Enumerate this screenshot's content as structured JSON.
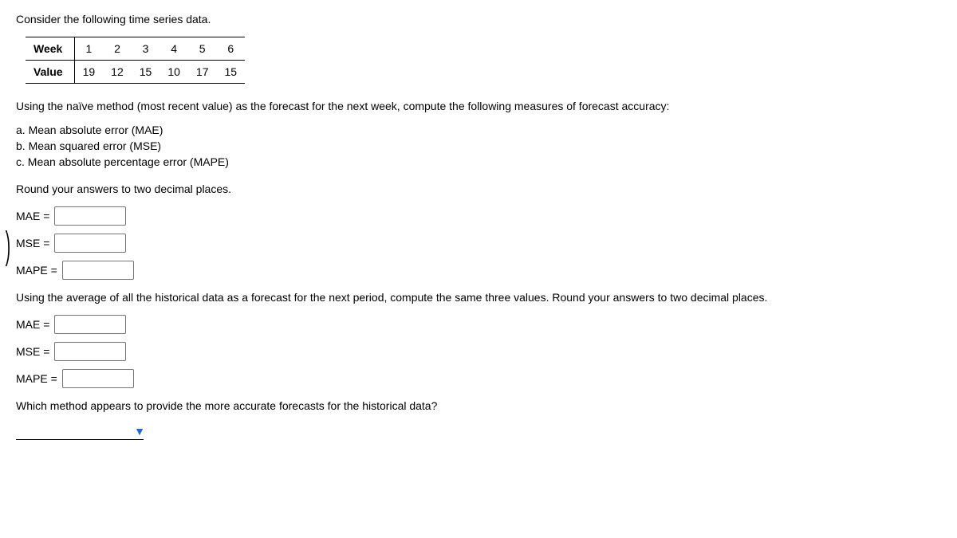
{
  "intro": "Consider the following time series data.",
  "table": {
    "row_label_1": "Week",
    "row_label_2": "Value",
    "weeks": [
      "1",
      "2",
      "3",
      "4",
      "5",
      "6"
    ],
    "values": [
      "19",
      "12",
      "15",
      "10",
      "17",
      "15"
    ]
  },
  "para1": "Using the naïve method (most recent value) as the forecast for the next week, compute the following measures of forecast accuracy:",
  "list": {
    "a": "a. Mean absolute error (MAE)",
    "b": "b. Mean squared error (MSE)",
    "c": "c. Mean absolute percentage error (MAPE)"
  },
  "round_note": "Round your answers to two decimal places.",
  "labels": {
    "mae": "MAE =",
    "mse": "MSE =",
    "mape": "MAPE ="
  },
  "para2": "Using the average of all the historical data as a forecast for the next period, compute the same three values. Round your answers to two decimal places.",
  "final_q": "Which method appears to provide the more accurate forecasts for the historical data?",
  "select_placeholder": ""
}
